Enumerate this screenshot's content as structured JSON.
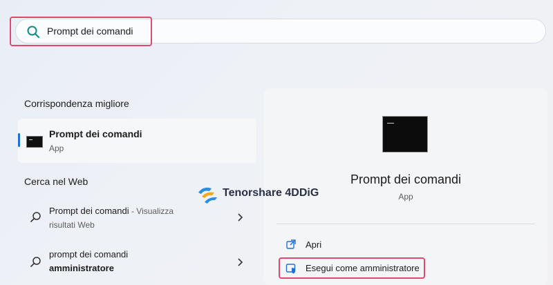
{
  "search": {
    "query": "Prompt dei comandi"
  },
  "left": {
    "best_match_title": "Corrispondenza migliore",
    "best_match": {
      "name": "Prompt dei comandi",
      "type": "App"
    },
    "web_title": "Cerca nel Web",
    "web_results": [
      {
        "main": "Prompt dei comandi",
        "suffix": " - Visualizza",
        "line2": "risultati Web"
      },
      {
        "main": "prompt dei comandi",
        "line2": "amministratore"
      }
    ]
  },
  "panel": {
    "app_name": "Prompt dei comandi",
    "app_type": "App",
    "actions": [
      {
        "label": "Apri",
        "icon": "open-external-icon"
      },
      {
        "label": "Esegui come amministratore",
        "icon": "admin-shield-icon"
      }
    ]
  },
  "watermark": {
    "text": "Tenorshare 4DDiG"
  },
  "colors": {
    "accent": "#1f6fd6",
    "highlight": "#e0486c"
  }
}
